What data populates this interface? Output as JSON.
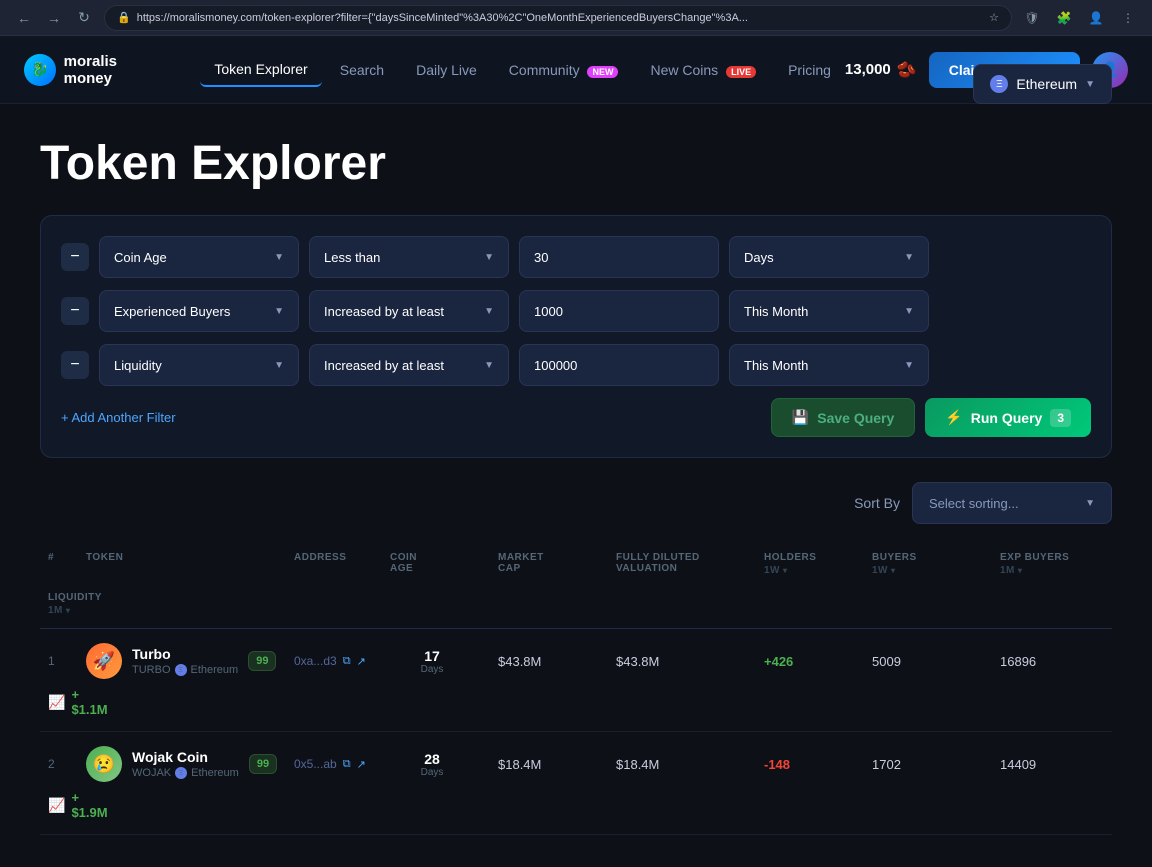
{
  "browser": {
    "url": "https://moralismoney.com/token-explorer?filter={\"daysSinceMinted\"%3A30%2C\"OneMonthExperiencedBuyersChange\"%3A...",
    "back_btn": "←",
    "forward_btn": "→",
    "refresh_btn": "↻"
  },
  "nav": {
    "logo_text": "moralis money",
    "items": [
      {
        "label": "Token Explorer",
        "active": true
      },
      {
        "label": "Search",
        "active": false
      },
      {
        "label": "Daily Live",
        "active": false
      },
      {
        "label": "Community",
        "active": false,
        "badge": "NEW"
      },
      {
        "label": "New Coins",
        "active": false,
        "badge": "LIVE"
      },
      {
        "label": "Pricing",
        "active": false
      }
    ],
    "beans_count": "13,000",
    "claim_btn": "Claim 500 Beans"
  },
  "page": {
    "title": "Token Explorer",
    "network": "Ethereum"
  },
  "filters": [
    {
      "type": "Coin Age",
      "condition": "Less than",
      "value": "30",
      "time": "Days"
    },
    {
      "type": "Experienced Buyers",
      "condition": "Increased by at least",
      "value": "1000",
      "time": "This Month"
    },
    {
      "type": "Liquidity",
      "condition": "Increased by at least",
      "value": "100000",
      "time": "This Month"
    }
  ],
  "add_filter_btn": "+ Add Another Filter",
  "save_query_btn": "Save Query",
  "run_query_btn": "Run Query",
  "query_count": "3",
  "sort_by_label": "Sort By",
  "sort_placeholder": "Select sorting...",
  "table": {
    "columns": [
      {
        "label": "#",
        "sub": ""
      },
      {
        "label": "TOKEN",
        "sub": ""
      },
      {
        "label": "ADDRESS",
        "sub": ""
      },
      {
        "label": "COIN AGE",
        "sub": ""
      },
      {
        "label": "MARKET CAP",
        "sub": ""
      },
      {
        "label": "FULLY DILUTED VALUATION",
        "sub": ""
      },
      {
        "label": "HOLDERS",
        "sub": "1W ↓"
      },
      {
        "label": "BUYERS",
        "sub": "1W ↓"
      },
      {
        "label": "EXP BUYERS",
        "sub": "1M ↓"
      },
      {
        "label": "LIQUIDITY",
        "sub": "1M ↓"
      }
    ],
    "rows": [
      {
        "rank": "1",
        "name": "Turbo",
        "symbol": "TURBO",
        "network": "Ethereum",
        "address": "0xa...d3",
        "coin_age_days": "17",
        "coin_age_label": "Days",
        "market_cap": "$43.8M",
        "fdv": "$43.8M",
        "holders": "+426",
        "holders_positive": true,
        "buyers": "5009",
        "exp_buyers": "16896",
        "liquidity": "+ $1.1M",
        "liquidity_trend": "up",
        "score": "99",
        "emoji": "🚀"
      },
      {
        "rank": "2",
        "name": "Wojak Coin",
        "symbol": "WOJAK",
        "network": "Ethereum",
        "address": "0x5...ab",
        "coin_age_days": "28",
        "coin_age_label": "Days",
        "market_cap": "$18.4M",
        "fdv": "$18.4M",
        "holders": "-148",
        "holders_positive": false,
        "buyers": "1702",
        "exp_buyers": "14409",
        "liquidity": "+ $1.9M",
        "liquidity_trend": "up",
        "score": "99",
        "emoji": "😢"
      }
    ]
  }
}
